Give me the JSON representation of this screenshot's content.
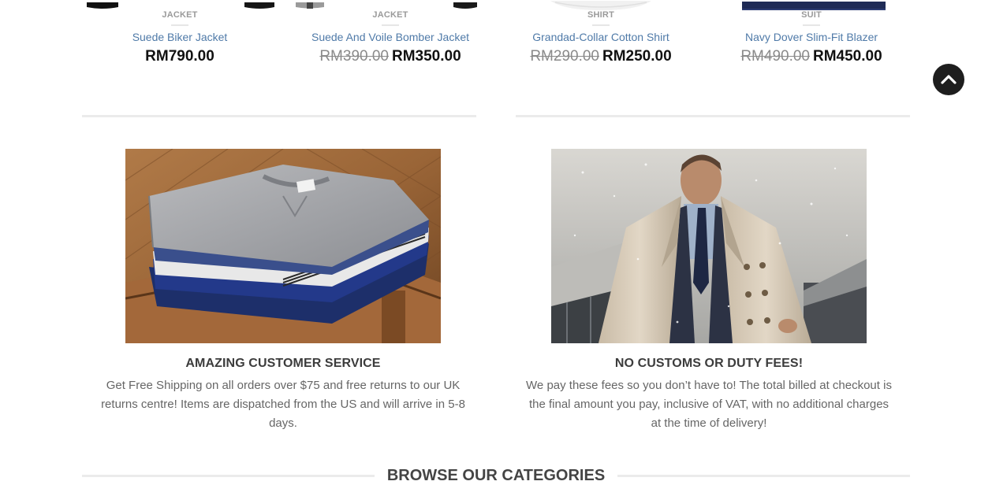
{
  "products": [
    {
      "category": "JACKET",
      "name": "Suede Biker Jacket",
      "old_price": "",
      "price": "RM790.00"
    },
    {
      "category": "JACKET",
      "name": "Suede And Voile Bomber Jacket",
      "old_price": "RM390.00",
      "price": "RM350.00"
    },
    {
      "category": "SHIRT",
      "name": "Grandad-Collar Cotton Shirt",
      "old_price": "RM290.00",
      "price": "RM250.00"
    },
    {
      "category": "SUIT",
      "name": "Navy Dover Slim-Fit Blazer",
      "old_price": "RM490.00",
      "price": "RM450.00"
    }
  ],
  "features": [
    {
      "title": "AMAZING CUSTOMER SERVICE",
      "text": "Get Free Shipping on all orders over $75 and free returns to our UK returns centre! Items are dispatched from the US and will arrive in 5-8 days."
    },
    {
      "title": "NO CUSTOMS OR DUTY FEES!",
      "text": "We pay these fees so you don’t have to! The total billed at checkout is the final amount you pay, inclusive of VAT, with no additional charges at the time of delivery!"
    }
  ],
  "categories": {
    "heading": "BROWSE OUR CATEGORIES"
  },
  "icons": {
    "back_to_top": "chevron-up-icon"
  },
  "colors": {
    "product_name": "#4f7aa8",
    "price": "#111111",
    "old_price": "#8a8a8a",
    "back_to_top_bg": "#1e1e1e"
  }
}
